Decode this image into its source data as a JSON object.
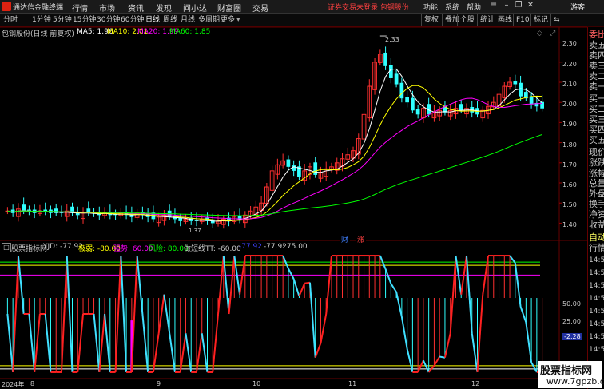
{
  "app": {
    "title": "通达信金融终端",
    "notice": "证券交易未登录 包钢股份",
    "guest": "游客"
  },
  "menu": [
    "行情",
    "市场",
    "资讯",
    "发现",
    "问小达",
    "财富圈",
    "交易"
  ],
  "right_menu": [
    "功能",
    "系统",
    "帮助"
  ],
  "periods": [
    "分时",
    "1分钟",
    "5分钟",
    "15分钟",
    "30分钟",
    "60分钟",
    "日线",
    "周线",
    "月线",
    "多周期",
    "更多"
  ],
  "active_period": "日线",
  "tools": [
    "复权",
    "叠加",
    "个股",
    "统计",
    "画线",
    "F10",
    "标记",
    "⇆"
  ],
  "stock": {
    "label": "包钢股份(日线 前复权)"
  },
  "ma": [
    {
      "label": "MA5: 1.96",
      "color": "#ffffff"
    },
    {
      "label": "MA10: 2.01",
      "color": "#ffff00"
    },
    {
      "label": "MA20: 1.99",
      "color": "#ff00ff"
    },
    {
      "label": "MA60: 1.85",
      "color": "#00ff00"
    }
  ],
  "price_axis": [
    "2.30",
    "2.20",
    "2.10",
    "2.00",
    "1.90",
    "1.80",
    "1.70",
    "1.60",
    "1.50",
    "1.40"
  ],
  "high_label": "2.33",
  "low_label": "1.37",
  "indicator": {
    "name": "股票指标网",
    "items": [
      {
        "label": "YJD: -77.92",
        "color": "#c8c8c8"
      },
      {
        "label": "极弱: -80.00",
        "color": "#ffff00"
      },
      {
        "label": "强势: 60.00",
        "color": "#ff00ff"
      },
      {
        "label": "风险: 80.00",
        "color": "#00ff00"
      },
      {
        "label": "做短线TT: -60.00",
        "color": "#c8c8c8"
      },
      {
        "label": "-77.92",
        "color": "#4040ff"
      },
      {
        "label": ": -77.92",
        "color": "#c8c8c8"
      },
      {
        "label": ": 75.00",
        "color": "#c8c8c8"
      }
    ],
    "axis": [
      "50.00",
      "25.00",
      "-2.28"
    ]
  },
  "badges": {
    "cai": "财",
    "zhang": "涨"
  },
  "x_axis": [
    "2024年",
    "8",
    "9",
    "10",
    "11",
    "12"
  ],
  "right_panel": [
    "委比",
    "卖五",
    "卖四",
    "卖三",
    "卖二",
    "卖一",
    "买一",
    "买二",
    "买三",
    "买四",
    "买五",
    "现价",
    "涨跌",
    "涨幅",
    "总量",
    "外盘",
    "换手",
    "净资",
    "收益"
  ],
  "right_panel2": [
    "自动",
    "行情"
  ],
  "right_times": [
    "14:50",
    "14:50",
    "14:50",
    "14:50",
    "14:50",
    "14:50",
    "14:50",
    "14:50"
  ],
  "watermark": {
    "line1": "股票指标网",
    "line2": "www.7gpzb.com"
  },
  "chart_data": {
    "type": "candlestick",
    "ylim": [
      1.35,
      2.35
    ],
    "closes": [
      1.46,
      1.45,
      1.47,
      1.46,
      1.46,
      1.45,
      1.46,
      1.46,
      1.45,
      1.45,
      1.45,
      1.46,
      1.45,
      1.44,
      1.45,
      1.45,
      1.45,
      1.44,
      1.45,
      1.44,
      1.44,
      1.45,
      1.44,
      1.43,
      1.45,
      1.44,
      1.43,
      1.42,
      1.43,
      1.44,
      1.43,
      1.42,
      1.41,
      1.42,
      1.41,
      1.41,
      1.42,
      1.41,
      1.4,
      1.41,
      1.42,
      1.41,
      1.43,
      1.42,
      1.44,
      1.46,
      1.48,
      1.5,
      1.58,
      1.66,
      1.69,
      1.71,
      1.68,
      1.66,
      1.63,
      1.66,
      1.68,
      1.64,
      1.65,
      1.67,
      1.68,
      1.7,
      1.72,
      1.74,
      1.76,
      1.82,
      1.94,
      2.08,
      2.2,
      2.24,
      2.18,
      2.12,
      2.09,
      2.02,
      2.0,
      1.96,
      1.94,
      1.97,
      1.94,
      1.95,
      1.96,
      1.95,
      1.96,
      1.97,
      1.96,
      1.97,
      1.95,
      1.94,
      1.96,
      1.98,
      2.0,
      2.04,
      2.08,
      2.1,
      2.09,
      2.03,
      2.02,
      1.99,
      1.98,
      1.97
    ],
    "ma5": 1.96,
    "ma10": 2.01,
    "ma20": 1.99,
    "ma60": 1.85,
    "indicator_lines": {
      "weak": -80,
      "strong": 60,
      "risk": 80
    }
  }
}
